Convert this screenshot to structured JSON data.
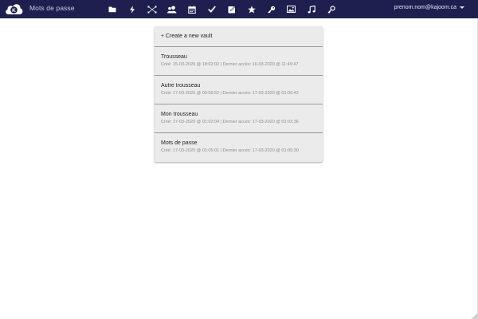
{
  "app": {
    "title": "Mots de passe",
    "logo_letter": "K"
  },
  "nav": {
    "icons": [
      "folder-icon",
      "lightning-icon",
      "tasks-icon",
      "contacts-icon",
      "calendar-icon",
      "checkmark-icon",
      "notes-icon",
      "star-icon",
      "key-icon",
      "image-icon",
      "music-icon",
      "password-key-icon"
    ]
  },
  "user": {
    "email": "prenom.nom@kajoom.ca"
  },
  "vaults": {
    "create_label": "+ Create a new vault",
    "items": [
      {
        "name": "Trousseau",
        "meta": "Créé: 15-03-2020 @ 18:02:02 | Dernier accès: 16-03-2020 @ 11:49:47"
      },
      {
        "name": "Autre trousseau",
        "meta": "Créé: 17-03-2020 @ 00:56:52 | Dernier accès: 17-03-2020 @ 01:00:42"
      },
      {
        "name": "Mon trousseau",
        "meta": "Créé: 17-03-2020 @ 01:02:04 | Dernier accès: 17-03-2020 @ 01:02:36"
      },
      {
        "name": "Mots de passe",
        "meta": "Créé: 17-03-2020 @ 01:05:01 | Dernier accès: 17-03-2020 @ 01:05:30"
      }
    ]
  },
  "colors": {
    "topbar": "#1f1f4f",
    "list_background": "#ebebeb"
  }
}
